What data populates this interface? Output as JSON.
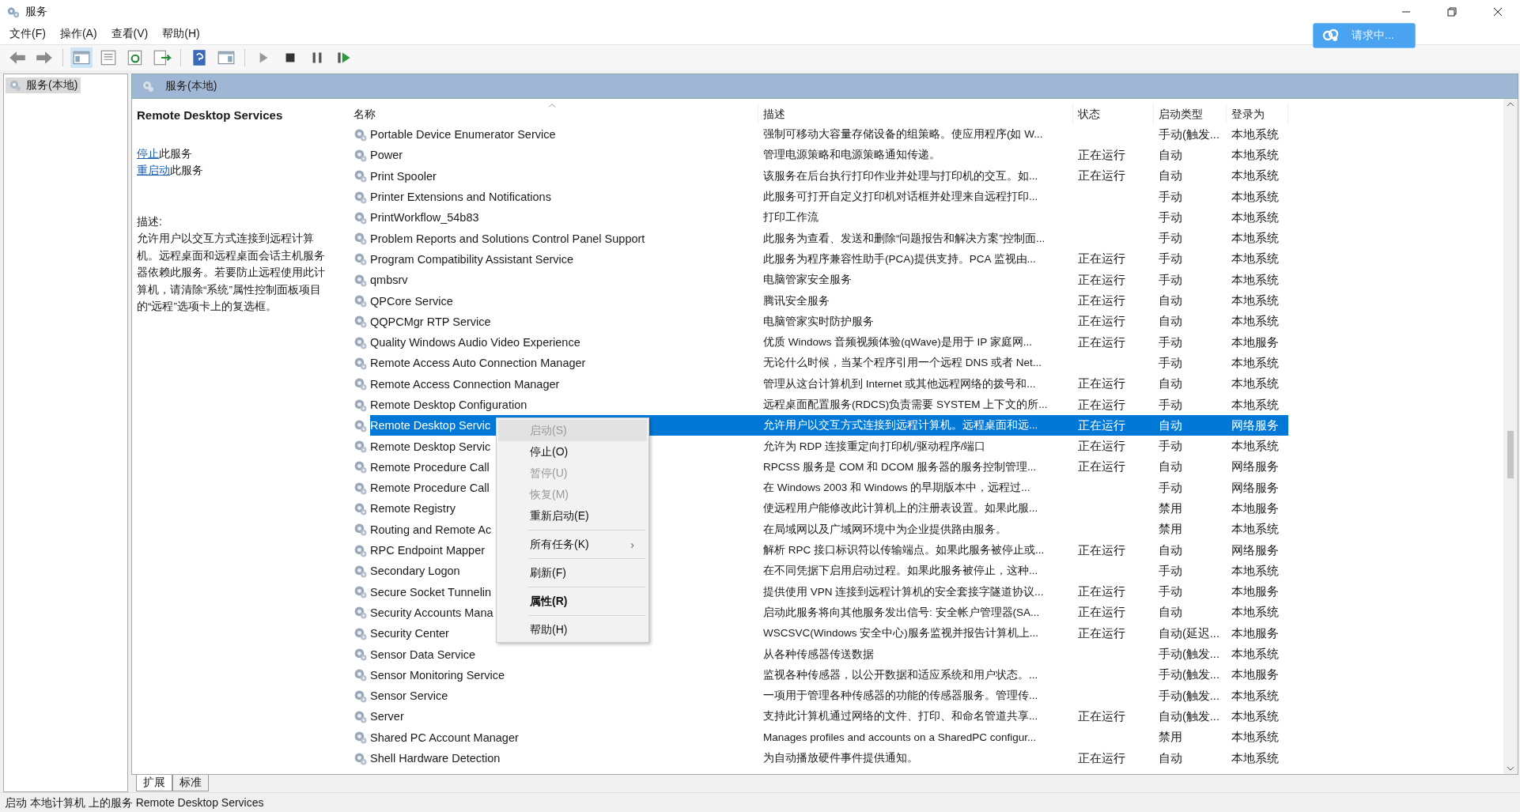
{
  "window": {
    "title": "服务"
  },
  "menu_bar": [
    "文件(F)",
    "操作(A)",
    "查看(V)",
    "帮助(H)"
  ],
  "cloud_button": {
    "label": "请求中..."
  },
  "tree": {
    "items": [
      {
        "label": "服务(本地)",
        "selected": true
      }
    ]
  },
  "pane_header": {
    "title": "服务(本地)"
  },
  "detail": {
    "title": "Remote Desktop Services",
    "actions": [
      {
        "link": "停止",
        "rest": "此服务"
      },
      {
        "link": "重启动",
        "rest": "此服务"
      }
    ],
    "description_label": "描述:",
    "description": "允许用户以交互方式连接到远程计算机。远程桌面和远程桌面会话主机服务器依赖此服务。若要防止远程使用此计算机，请清除“系统”属性控制面板项目的“远程”选项卡上的复选框。"
  },
  "table": {
    "columns": [
      "名称",
      "描述",
      "状态",
      "启动类型",
      "登录为"
    ],
    "rows": [
      {
        "name": "Portable Device Enumerator Service",
        "description": "强制可移动大容量存储设备的组策略。使应用程序(如 W...",
        "status": "",
        "startup": "手动(触发...",
        "logon": "本地系统",
        "selected": false
      },
      {
        "name": "Power",
        "description": "管理电源策略和电源策略通知传递。",
        "status": "正在运行",
        "startup": "自动",
        "logon": "本地系统",
        "selected": false
      },
      {
        "name": "Print Spooler",
        "description": "该服务在后台执行打印作业并处理与打印机的交互。如...",
        "status": "正在运行",
        "startup": "自动",
        "logon": "本地系统",
        "selected": false
      },
      {
        "name": "Printer Extensions and Notifications",
        "description": "此服务可打开自定义打印机对话框并处理来自远程打印...",
        "status": "",
        "startup": "手动",
        "logon": "本地系统",
        "selected": false
      },
      {
        "name": "PrintWorkflow_54b83",
        "description": "打印工作流",
        "status": "",
        "startup": "手动",
        "logon": "本地系统",
        "selected": false
      },
      {
        "name": "Problem Reports and Solutions Control Panel Support",
        "description": "此服务为查看、发送和删除“问题报告和解决方案”控制面...",
        "status": "",
        "startup": "手动",
        "logon": "本地系统",
        "selected": false
      },
      {
        "name": "Program Compatibility Assistant Service",
        "description": "此服务为程序兼容性助手(PCA)提供支持。PCA 监视由...",
        "status": "正在运行",
        "startup": "手动",
        "logon": "本地系统",
        "selected": false
      },
      {
        "name": "qmbsrv",
        "description": "电脑管家安全服务",
        "status": "正在运行",
        "startup": "手动",
        "logon": "本地系统",
        "selected": false
      },
      {
        "name": "QPCore Service",
        "description": "腾讯安全服务",
        "status": "正在运行",
        "startup": "自动",
        "logon": "本地系统",
        "selected": false
      },
      {
        "name": "QQPCMgr RTP Service",
        "description": "电脑管家实时防护服务",
        "status": "正在运行",
        "startup": "自动",
        "logon": "本地系统",
        "selected": false
      },
      {
        "name": "Quality Windows Audio Video Experience",
        "description": "优质 Windows 音频视频体验(qWave)是用于 IP 家庭网...",
        "status": "正在运行",
        "startup": "手动",
        "logon": "本地服务",
        "selected": false
      },
      {
        "name": "Remote Access Auto Connection Manager",
        "description": "无论什么时候，当某个程序引用一个远程 DNS 或者 Net...",
        "status": "",
        "startup": "手动",
        "logon": "本地系统",
        "selected": false
      },
      {
        "name": "Remote Access Connection Manager",
        "description": "管理从这台计算机到 Internet 或其他远程网络的拨号和...",
        "status": "正在运行",
        "startup": "自动",
        "logon": "本地系统",
        "selected": false
      },
      {
        "name": "Remote Desktop Configuration",
        "description": "远程桌面配置服务(RDCS)负责需要 SYSTEM 上下文的所...",
        "status": "正在运行",
        "startup": "手动",
        "logon": "本地系统",
        "selected": false
      },
      {
        "name": "Remote Desktop Servic",
        "description": "允许用户以交互方式连接到远程计算机。远程桌面和远...",
        "status": "正在运行",
        "startup": "自动",
        "logon": "网络服务",
        "selected": true
      },
      {
        "name": "Remote Desktop Servic",
        "description": "允许为 RDP 连接重定向打印机/驱动程序/端口",
        "status": "正在运行",
        "startup": "手动",
        "logon": "本地系统",
        "selected": false
      },
      {
        "name": "Remote Procedure Call",
        "description": "RPCSS 服务是 COM 和 DCOM 服务器的服务控制管理...",
        "status": "正在运行",
        "startup": "自动",
        "logon": "网络服务",
        "selected": false
      },
      {
        "name": "Remote Procedure Call",
        "description": "在 Windows 2003 和 Windows 的早期版本中，远程过...",
        "status": "",
        "startup": "手动",
        "logon": "网络服务",
        "selected": false
      },
      {
        "name": "Remote Registry",
        "description": "使远程用户能修改此计算机上的注册表设置。如果此服...",
        "status": "",
        "startup": "禁用",
        "logon": "本地服务",
        "selected": false
      },
      {
        "name": "Routing and Remote Ac",
        "description": "在局域网以及广域网环境中为企业提供路由服务。",
        "status": "",
        "startup": "禁用",
        "logon": "本地系统",
        "selected": false
      },
      {
        "name": "RPC Endpoint Mapper",
        "description": "解析 RPC 接口标识符以传输端点。如果此服务被停止或...",
        "status": "正在运行",
        "startup": "自动",
        "logon": "网络服务",
        "selected": false
      },
      {
        "name": "Secondary Logon",
        "description": "在不同凭据下启用启动过程。如果此服务被停止，这种...",
        "status": "",
        "startup": "手动",
        "logon": "本地系统",
        "selected": false
      },
      {
        "name": "Secure Socket Tunnelin",
        "description": "提供使用 VPN 连接到远程计算机的安全套接字隧道协议...",
        "status": "正在运行",
        "startup": "手动",
        "logon": "本地服务",
        "selected": false
      },
      {
        "name": "Security Accounts Mana",
        "description": "启动此服务将向其他服务发出信号: 安全帐户管理器(SA...",
        "status": "正在运行",
        "startup": "自动",
        "logon": "本地系统",
        "selected": false
      },
      {
        "name": "Security Center",
        "description": "WSCSVC(Windows 安全中心)服务监视并报告计算机上...",
        "status": "正在运行",
        "startup": "自动(延迟...",
        "logon": "本地服务",
        "selected": false
      },
      {
        "name": "Sensor Data Service",
        "description": "从各种传感器传送数据",
        "status": "",
        "startup": "手动(触发...",
        "logon": "本地系统",
        "selected": false
      },
      {
        "name": "Sensor Monitoring Service",
        "description": "监视各种传感器，以公开数据和适应系统和用户状态。...",
        "status": "",
        "startup": "手动(触发...",
        "logon": "本地服务",
        "selected": false
      },
      {
        "name": "Sensor Service",
        "description": "一项用于管理各种传感器的功能的传感器服务。管理传...",
        "status": "",
        "startup": "手动(触发...",
        "logon": "本地系统",
        "selected": false
      },
      {
        "name": "Server",
        "description": "支持此计算机通过网络的文件、打印、和命名管道共享...",
        "status": "正在运行",
        "startup": "自动(触发...",
        "logon": "本地系统",
        "selected": false
      },
      {
        "name": "Shared PC Account Manager",
        "description": "Manages profiles and accounts on a SharedPC configur...",
        "status": "",
        "startup": "禁用",
        "logon": "本地系统",
        "selected": false
      },
      {
        "name": "Shell Hardware Detection",
        "description": "为自动播放硬件事件提供通知。",
        "status": "正在运行",
        "startup": "自动",
        "logon": "本地系统",
        "selected": false
      }
    ]
  },
  "context_menu": [
    {
      "label": "启动(S)",
      "disabled": true,
      "selected": true,
      "kind": "item"
    },
    {
      "label": "停止(O)",
      "disabled": false,
      "selected": false,
      "kind": "item"
    },
    {
      "label": "暂停(U)",
      "disabled": true,
      "selected": false,
      "kind": "item"
    },
    {
      "label": "恢复(M)",
      "disabled": true,
      "selected": false,
      "kind": "item"
    },
    {
      "label": "重新启动(E)",
      "disabled": false,
      "selected": false,
      "kind": "item"
    },
    {
      "kind": "separator"
    },
    {
      "label": "所有任务(K)",
      "disabled": false,
      "selected": false,
      "kind": "submenu",
      "arrow": "›"
    },
    {
      "kind": "separator"
    },
    {
      "label": "刷新(F)",
      "disabled": false,
      "selected": false,
      "kind": "item"
    },
    {
      "kind": "separator"
    },
    {
      "label": "属性(R)",
      "disabled": false,
      "selected": false,
      "kind": "default"
    },
    {
      "kind": "separator"
    },
    {
      "label": "帮助(H)",
      "disabled": false,
      "selected": false,
      "kind": "item"
    }
  ],
  "view_tabs": [
    {
      "label": "扩展",
      "selected": true
    },
    {
      "label": "标准",
      "selected": false
    }
  ],
  "status_bar": "启动 本地计算机 上的服务 Remote Desktop Services"
}
